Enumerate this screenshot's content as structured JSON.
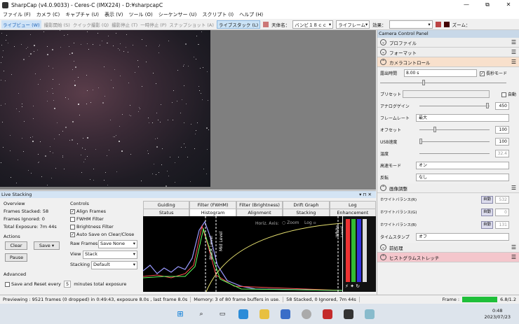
{
  "window": {
    "title": "SharpCap (v4.0.9033) - Ceres-C (IMX224) - D:¥sharpcapC",
    "min": "—",
    "max": "⧉",
    "close": "✕"
  },
  "menu": [
    "ライブビュー (W)"
  ],
  "menubar": [
    "ファイル (F)",
    "カメラ (C)",
    "キャプチャ (U)",
    "表示 (V)",
    "ツール (O)",
    "シーケンサー (U)",
    "スクリプト (I)",
    "ヘルプ (H)"
  ],
  "toolbar": {
    "live": "ライブビュー (W)",
    "start": "撮影開始 (S)",
    "quick": "クイック撮影 (Q)",
    "stop": "撮影停止 (T)",
    "pause": "一時停止 (P)",
    "snapshot": "スナップショット (A)",
    "livestack": "ライブスタック (L)",
    "target_label": "天体名：",
    "target_value": "バンビ１８ｃｃ",
    "frame": "ライフレーム",
    "effect_label": "効果：",
    "zoom_label": "ズーム："
  },
  "panel": {
    "title": "Camera Control Panel",
    "sections": {
      "profile": "プロファイル",
      "format": "フォーマット",
      "camera_control": "カメラコントロール",
      "image_adjust": "画像調整",
      "preprocess": "前処理",
      "histogram_stretch": "ヒストグラムストレッチ"
    },
    "exposure_label": "露出時間",
    "exposure_value": "8.00 s",
    "long_mode": "長秒モード",
    "preset_label": "プリセット",
    "preset_auto": "自動",
    "rows": [
      {
        "label": "アナログゲイン",
        "value": "450"
      },
      {
        "label": "フレームレート",
        "value": "最大"
      },
      {
        "label": "オフセット",
        "value": "100"
      },
      {
        "label": "USB速度",
        "value": "100"
      },
      {
        "label": "温度",
        "value": "32.4"
      },
      {
        "label": "高速モード",
        "value": "オン"
      },
      {
        "label": "反転",
        "value": "なし"
      }
    ],
    "wb": [
      {
        "label": "ホワイトバランス(R)",
        "auto": "自動",
        "value": "532"
      },
      {
        "label": "ホワイトバランス(G)",
        "auto": "自動",
        "value": "0"
      },
      {
        "label": "ホワイトバランス(B)",
        "auto": "自動",
        "value": "131"
      }
    ],
    "timestamp_label": "タイムスタンプ",
    "timestamp_value": "オフ"
  },
  "livestack": {
    "title": "Live Stacking",
    "overview": "Overview",
    "stacked": "Frames Stacked: 58",
    "ignored": "Frames Ignored: 0",
    "exposure": "Total Exposure:  7m 44s",
    "controls": "Controls",
    "align": "Align Frames",
    "fwhm": "FWHM Filter",
    "brightness": "Brightness Filter",
    "autosave": "Auto Save on Clear/Close",
    "actions": "Actions",
    "clear": "Clear",
    "save": "Save",
    "pause": "Pause",
    "raw_label": "Raw Frames",
    "raw_value": "Save None",
    "view_label": "View",
    "view_value": "Stack",
    "stacking_label": "Stacking",
    "stacking_value": "Default",
    "advanced": "Advanced",
    "save_reset": "Save and Reset every",
    "minutes_value": "5",
    "minutes_label": "minutes total exposure",
    "tabs_top": [
      "Guiding",
      "Filter (FWHM)",
      "Filter (Brightness)",
      "Drift Graph",
      "Log"
    ],
    "tabs_bottom": [
      "Status",
      "Histogram",
      "Alignment",
      "Stacking",
      "Enhancement"
    ],
    "hist_labels": {
      "axis": "Horiz. Axis:",
      "zoom": "Zoom",
      "log": "Log",
      "white": "White Level",
      "mid": "Mid Level",
      "black": "Black Level"
    }
  },
  "status": {
    "preview": "Previewing : 9521 frames (0 dropped) in 0:49:43, exposure 8.0s , last frame 8.0s",
    "memory": "Memory: 3 of 80 frame buffers in use.",
    "stacked": "58 Stacked, 0 Ignored, 7m 44s",
    "frame_label": "Frame :",
    "frame_value": "6.8/1.2"
  },
  "taskbar": {
    "time": "0:48",
    "date": "2023/07/23"
  },
  "colors": {
    "accent": "#0078d7",
    "frame_bar": "#1fbf3a"
  }
}
